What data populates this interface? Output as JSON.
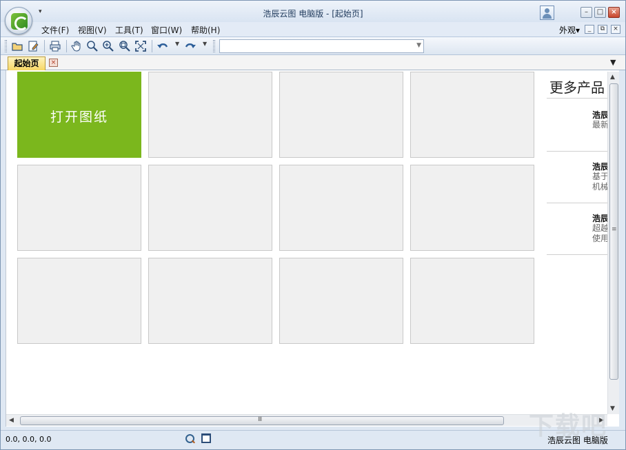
{
  "window": {
    "title": "浩辰云图 电脑版 - [起始页]"
  },
  "quick_access": {
    "dropdown": "▾"
  },
  "caption_buttons": {
    "minimize": "–",
    "maximize": "□",
    "close": "×"
  },
  "menu": {
    "items": [
      "文件(F)",
      "视图(V)",
      "工具(T)",
      "窗口(W)",
      "帮助(H)"
    ],
    "appearance": "外观▾",
    "mdi": {
      "minimize": "_",
      "restore": "⧉",
      "close": "×"
    }
  },
  "toolbar": {
    "icons": [
      "open-folder-icon",
      "save-icon",
      "print-icon",
      "pan-hand-icon",
      "zoom-icon",
      "zoom-in-icon",
      "zoom-window-icon",
      "zoom-extents-icon",
      "undo-icon",
      "redo-icon"
    ],
    "combo_value": ""
  },
  "tabs": {
    "active": "起始页",
    "close": "×",
    "menu": "▼"
  },
  "tiles": {
    "open_drawing": "打开图纸"
  },
  "more_products": {
    "title": "更多产品",
    "items": [
      {
        "name": "浩辰",
        "desc": [
          "最新"
        ]
      },
      {
        "name": "浩辰",
        "desc": [
          "基于",
          "机械"
        ]
      },
      {
        "name": "浩辰",
        "desc": [
          "超越",
          "使用"
        ]
      }
    ]
  },
  "scrollbars": {
    "up": "▲",
    "down": "▼",
    "left": "◀",
    "right": "▶",
    "grip_v": "≡",
    "grip_h": "Ⅲ"
  },
  "status": {
    "coords": "0.0, 0.0, 0.0",
    "app_name": "浩辰云图 电脑版"
  },
  "watermark": "下载吧",
  "colors": {
    "accent": "#7bb71d",
    "tab_active": "#f7d766"
  }
}
